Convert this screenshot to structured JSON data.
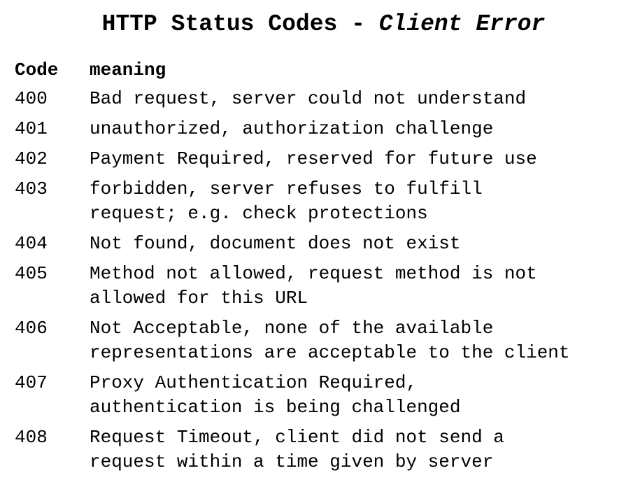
{
  "title": {
    "prefix": "HTTP Status Codes - ",
    "emphasis": "Client Error"
  },
  "table": {
    "headers": {
      "code": "Code",
      "meaning": "meaning"
    },
    "rows": [
      {
        "code": "400",
        "lines": [
          "Bad request, server could not understand"
        ]
      },
      {
        "code": "401",
        "lines": [
          "unauthorized, authorization challenge"
        ]
      },
      {
        "code": "402",
        "lines": [
          "Payment Required, reserved for future use"
        ]
      },
      {
        "code": "403",
        "lines": [
          "forbidden, server refuses to fulfill",
          "request; e.g. check protections"
        ]
      },
      {
        "code": "404",
        "lines": [
          "Not found, document does not exist"
        ]
      },
      {
        "code": "405",
        "lines": [
          "Method not allowed, request method is not",
          "allowed for this URL"
        ]
      },
      {
        "code": "406",
        "lines": [
          "Not Acceptable, none of the available",
          "representations are acceptable to the client"
        ]
      },
      {
        "code": "407",
        "lines": [
          "Proxy Authentication Required,",
          "authentication is being challenged"
        ]
      },
      {
        "code": "408",
        "lines": [
          "Request Timeout, client did not send a",
          "request within a time given by server"
        ]
      }
    ]
  }
}
